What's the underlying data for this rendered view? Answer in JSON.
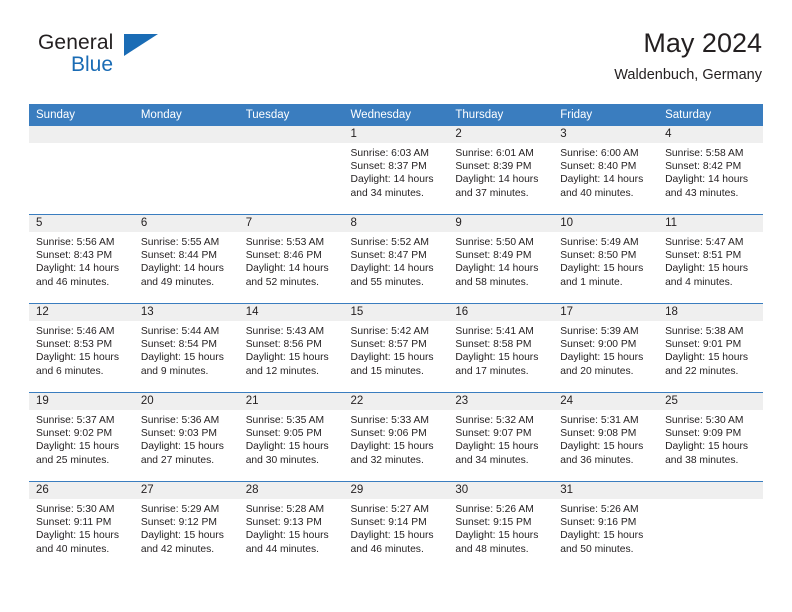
{
  "brand": {
    "line1": "General",
    "line2": "Blue",
    "triangle_color": "#1a6cb5"
  },
  "header": {
    "title": "May 2024",
    "subtitle": "Waldenbuch, Germany"
  },
  "theme": {
    "header_blue": "#3a7dbf",
    "band_gray": "#efefef",
    "text": "#231f20"
  },
  "columns": [
    "Sunday",
    "Monday",
    "Tuesday",
    "Wednesday",
    "Thursday",
    "Friday",
    "Saturday"
  ],
  "labels": {
    "sunrise_prefix": "Sunrise: ",
    "sunset_prefix": "Sunset: ",
    "daylight_prefix": "Daylight: "
  },
  "weeks": [
    [
      {
        "day": "",
        "empty": true
      },
      {
        "day": "",
        "empty": true
      },
      {
        "day": "",
        "empty": true
      },
      {
        "day": "1",
        "sunrise": "Sunrise: 6:03 AM",
        "sunset": "Sunset: 8:37 PM",
        "daylight1": "Daylight: 14 hours",
        "daylight2": "and 34 minutes."
      },
      {
        "day": "2",
        "sunrise": "Sunrise: 6:01 AM",
        "sunset": "Sunset: 8:39 PM",
        "daylight1": "Daylight: 14 hours",
        "daylight2": "and 37 minutes."
      },
      {
        "day": "3",
        "sunrise": "Sunrise: 6:00 AM",
        "sunset": "Sunset: 8:40 PM",
        "daylight1": "Daylight: 14 hours",
        "daylight2": "and 40 minutes."
      },
      {
        "day": "4",
        "sunrise": "Sunrise: 5:58 AM",
        "sunset": "Sunset: 8:42 PM",
        "daylight1": "Daylight: 14 hours",
        "daylight2": "and 43 minutes."
      }
    ],
    [
      {
        "day": "5",
        "sunrise": "Sunrise: 5:56 AM",
        "sunset": "Sunset: 8:43 PM",
        "daylight1": "Daylight: 14 hours",
        "daylight2": "and 46 minutes."
      },
      {
        "day": "6",
        "sunrise": "Sunrise: 5:55 AM",
        "sunset": "Sunset: 8:44 PM",
        "daylight1": "Daylight: 14 hours",
        "daylight2": "and 49 minutes."
      },
      {
        "day": "7",
        "sunrise": "Sunrise: 5:53 AM",
        "sunset": "Sunset: 8:46 PM",
        "daylight1": "Daylight: 14 hours",
        "daylight2": "and 52 minutes."
      },
      {
        "day": "8",
        "sunrise": "Sunrise: 5:52 AM",
        "sunset": "Sunset: 8:47 PM",
        "daylight1": "Daylight: 14 hours",
        "daylight2": "and 55 minutes."
      },
      {
        "day": "9",
        "sunrise": "Sunrise: 5:50 AM",
        "sunset": "Sunset: 8:49 PM",
        "daylight1": "Daylight: 14 hours",
        "daylight2": "and 58 minutes."
      },
      {
        "day": "10",
        "sunrise": "Sunrise: 5:49 AM",
        "sunset": "Sunset: 8:50 PM",
        "daylight1": "Daylight: 15 hours",
        "daylight2": "and 1 minute."
      },
      {
        "day": "11",
        "sunrise": "Sunrise: 5:47 AM",
        "sunset": "Sunset: 8:51 PM",
        "daylight1": "Daylight: 15 hours",
        "daylight2": "and 4 minutes."
      }
    ],
    [
      {
        "day": "12",
        "sunrise": "Sunrise: 5:46 AM",
        "sunset": "Sunset: 8:53 PM",
        "daylight1": "Daylight: 15 hours",
        "daylight2": "and 6 minutes."
      },
      {
        "day": "13",
        "sunrise": "Sunrise: 5:44 AM",
        "sunset": "Sunset: 8:54 PM",
        "daylight1": "Daylight: 15 hours",
        "daylight2": "and 9 minutes."
      },
      {
        "day": "14",
        "sunrise": "Sunrise: 5:43 AM",
        "sunset": "Sunset: 8:56 PM",
        "daylight1": "Daylight: 15 hours",
        "daylight2": "and 12 minutes."
      },
      {
        "day": "15",
        "sunrise": "Sunrise: 5:42 AM",
        "sunset": "Sunset: 8:57 PM",
        "daylight1": "Daylight: 15 hours",
        "daylight2": "and 15 minutes."
      },
      {
        "day": "16",
        "sunrise": "Sunrise: 5:41 AM",
        "sunset": "Sunset: 8:58 PM",
        "daylight1": "Daylight: 15 hours",
        "daylight2": "and 17 minutes."
      },
      {
        "day": "17",
        "sunrise": "Sunrise: 5:39 AM",
        "sunset": "Sunset: 9:00 PM",
        "daylight1": "Daylight: 15 hours",
        "daylight2": "and 20 minutes."
      },
      {
        "day": "18",
        "sunrise": "Sunrise: 5:38 AM",
        "sunset": "Sunset: 9:01 PM",
        "daylight1": "Daylight: 15 hours",
        "daylight2": "and 22 minutes."
      }
    ],
    [
      {
        "day": "19",
        "sunrise": "Sunrise: 5:37 AM",
        "sunset": "Sunset: 9:02 PM",
        "daylight1": "Daylight: 15 hours",
        "daylight2": "and 25 minutes."
      },
      {
        "day": "20",
        "sunrise": "Sunrise: 5:36 AM",
        "sunset": "Sunset: 9:03 PM",
        "daylight1": "Daylight: 15 hours",
        "daylight2": "and 27 minutes."
      },
      {
        "day": "21",
        "sunrise": "Sunrise: 5:35 AM",
        "sunset": "Sunset: 9:05 PM",
        "daylight1": "Daylight: 15 hours",
        "daylight2": "and 30 minutes."
      },
      {
        "day": "22",
        "sunrise": "Sunrise: 5:33 AM",
        "sunset": "Sunset: 9:06 PM",
        "daylight1": "Daylight: 15 hours",
        "daylight2": "and 32 minutes."
      },
      {
        "day": "23",
        "sunrise": "Sunrise: 5:32 AM",
        "sunset": "Sunset: 9:07 PM",
        "daylight1": "Daylight: 15 hours",
        "daylight2": "and 34 minutes."
      },
      {
        "day": "24",
        "sunrise": "Sunrise: 5:31 AM",
        "sunset": "Sunset: 9:08 PM",
        "daylight1": "Daylight: 15 hours",
        "daylight2": "and 36 minutes."
      },
      {
        "day": "25",
        "sunrise": "Sunrise: 5:30 AM",
        "sunset": "Sunset: 9:09 PM",
        "daylight1": "Daylight: 15 hours",
        "daylight2": "and 38 minutes."
      }
    ],
    [
      {
        "day": "26",
        "sunrise": "Sunrise: 5:30 AM",
        "sunset": "Sunset: 9:11 PM",
        "daylight1": "Daylight: 15 hours",
        "daylight2": "and 40 minutes."
      },
      {
        "day": "27",
        "sunrise": "Sunrise: 5:29 AM",
        "sunset": "Sunset: 9:12 PM",
        "daylight1": "Daylight: 15 hours",
        "daylight2": "and 42 minutes."
      },
      {
        "day": "28",
        "sunrise": "Sunrise: 5:28 AM",
        "sunset": "Sunset: 9:13 PM",
        "daylight1": "Daylight: 15 hours",
        "daylight2": "and 44 minutes."
      },
      {
        "day": "29",
        "sunrise": "Sunrise: 5:27 AM",
        "sunset": "Sunset: 9:14 PM",
        "daylight1": "Daylight: 15 hours",
        "daylight2": "and 46 minutes."
      },
      {
        "day": "30",
        "sunrise": "Sunrise: 5:26 AM",
        "sunset": "Sunset: 9:15 PM",
        "daylight1": "Daylight: 15 hours",
        "daylight2": "and 48 minutes."
      },
      {
        "day": "31",
        "sunrise": "Sunrise: 5:26 AM",
        "sunset": "Sunset: 9:16 PM",
        "daylight1": "Daylight: 15 hours",
        "daylight2": "and 50 minutes."
      },
      {
        "day": "",
        "empty": true
      }
    ]
  ]
}
